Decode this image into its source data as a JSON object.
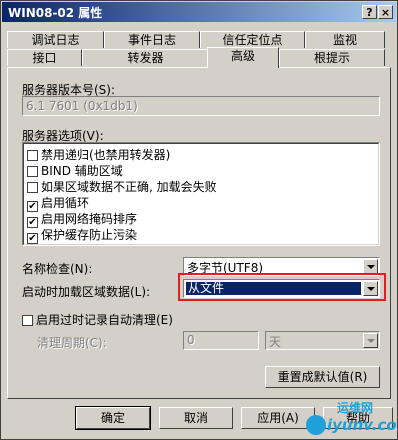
{
  "window": {
    "title": "WIN08-02 属性",
    "help_btn": "?",
    "close_btn": "×"
  },
  "tabs_row1": [
    "调试日志",
    "事件日志",
    "信任定位点",
    "监视"
  ],
  "tabs_row2": [
    "接口",
    "转发器",
    "高级",
    "根提示"
  ],
  "active_tab": "高级",
  "advanced": {
    "version_label": "服务器版本号(S):",
    "version_value": "6.1 7601 (0x1db1)",
    "options_label": "服务器选项(V):",
    "options": [
      {
        "label": "禁用递归(也禁用转发器)",
        "checked": false
      },
      {
        "label": "BIND 辅助区域",
        "checked": false
      },
      {
        "label": "如果区域数据不正确, 加载会失败",
        "checked": false
      },
      {
        "label": "启用循环",
        "checked": true
      },
      {
        "label": "启用网络掩码排序",
        "checked": true
      },
      {
        "label": "保护缓存防止污染",
        "checked": true
      }
    ],
    "name_check_label": "名称检查(N):",
    "name_check_value": "多字节(UTF8)",
    "load_zone_label": "启动时加载区域数据(L):",
    "load_zone_value": "从文件",
    "scavenging_label": "启用过时记录自动清理(E)",
    "scavenging_checked": false,
    "period_label": "清理周期(C):",
    "period_value": "0",
    "period_unit": "天",
    "reset_btn": "重置成默认值(R)"
  },
  "buttons": {
    "ok": "确定",
    "cancel": "取消",
    "apply": "应用(A)",
    "help": "帮助"
  },
  "watermark": {
    "top": "运维网",
    "bottom": "iyunv.com"
  },
  "colors": {
    "titlebar": "#0a246a",
    "highlight": "#0a246a",
    "annotation": "#e02020",
    "watermark": "#1fa0d8"
  }
}
